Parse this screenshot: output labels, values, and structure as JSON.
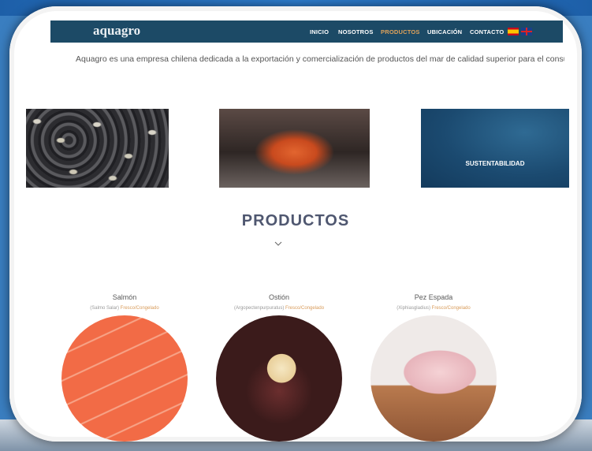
{
  "nav": {
    "logo": "aquagro",
    "items": [
      {
        "label": "INICIO"
      },
      {
        "label": "NOSOTROS"
      },
      {
        "label": "PRODUCTOS"
      },
      {
        "label": "UBICACIÓN"
      },
      {
        "label": "CONTACTO"
      }
    ],
    "active_color": "#e0a25a"
  },
  "intro": {
    "text": "Aquagro es una empresa chilena dedicada a la exportación y comercialización de productos del mar de calidad superior para el consumo huma"
  },
  "gallery": {
    "sustainability_caption": "SUSTENTABILIDAD"
  },
  "products": {
    "title": "PRODUCTOS",
    "items": [
      {
        "name": "Salmón",
        "scientific": "(Salmo Salar)",
        "state": "Fresco/Congelado"
      },
      {
        "name": "Ostión",
        "scientific": "(Argopectenpurpuratus)",
        "state": "Fresco/Congelado"
      },
      {
        "name": "Pez Espada",
        "scientific": "(Xiphiasgladius)",
        "state": "Fresco/Congelado"
      }
    ]
  },
  "colors": {
    "navbar": "#1c4a66",
    "title": "#4f5770",
    "accent": "#d89b5a"
  }
}
